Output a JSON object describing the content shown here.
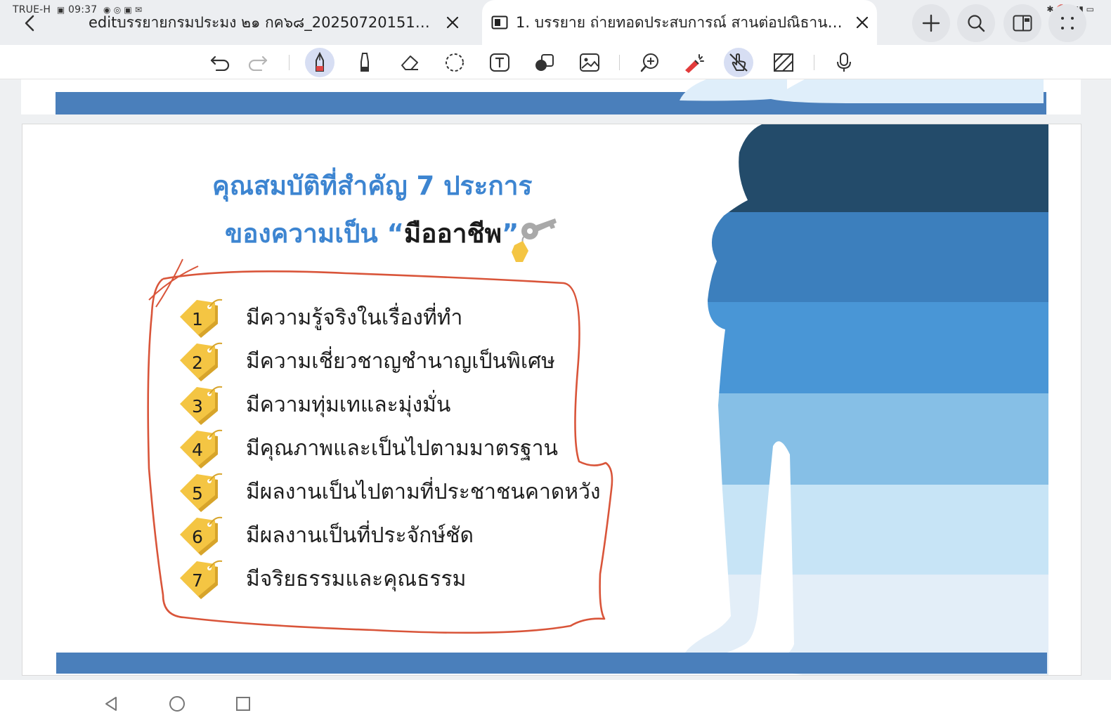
{
  "status_bar": {
    "carrier": "TRUE-H",
    "time": "09:37"
  },
  "tabs": [
    {
      "title": "editบรรยายกรมประมง ๒๑ กค๖๘_202507201515_0...",
      "active": false
    },
    {
      "title": "1. บรรยาย ถ่ายทอดประสบการณ์ สานต่อปณิธาน ...",
      "active": true
    }
  ],
  "top_actions": [
    "plus-icon",
    "search-icon",
    "split-view-icon",
    "more-icon"
  ],
  "toolbar": {
    "tools": [
      "undo-icon",
      "redo-icon",
      "pen-icon",
      "highlighter-icon",
      "eraser-icon",
      "lasso-icon",
      "text-box-icon",
      "shapes-icon",
      "image-icon",
      "zoom-icon",
      "laser-pointer-icon",
      "finger-draw-icon",
      "background-pattern-icon",
      "voice-icon"
    ],
    "active_tools": [
      "pen-icon",
      "finger-draw-icon"
    ]
  },
  "slide": {
    "title_line1": "คุณสมบัติที่สำคัญ 7 ประการ",
    "title_line2_prefix": "ของความเป็น ",
    "title_line2_quote_open": "“",
    "title_line2_emphasis": "มืออาชีพ",
    "title_line2_quote_close": "”",
    "items": [
      {
        "number": "1",
        "text": "มีความรู้จริงในเรื่องที่ทำ"
      },
      {
        "number": "2",
        "text": "มีความเชี่ยวชาญชำนาญเป็นพิเศษ"
      },
      {
        "number": "3",
        "text": "มีความทุ่มเทและมุ่งมั่น"
      },
      {
        "number": "4",
        "text": "มีคุณภาพและเป็นไปตามมาตรฐาน"
      },
      {
        "number": "5",
        "text": "มีผลงานเป็นไปตามที่ประชาชนคาดหวัง"
      },
      {
        "number": "6",
        "text": "มีผลงานเป็นที่ประจักษ์ชัด"
      },
      {
        "number": "7",
        "text": "มีจริยธรรมและคุณธรรม"
      }
    ],
    "colors": {
      "title_blue": "#3d85d1",
      "band_blue": "#4a7fbb",
      "tag_yellow": "#f4c543",
      "ink_red": "#d9553a",
      "silhouette_stripes": [
        "#234b6a",
        "#3c7fbd",
        "#4996d6",
        "#86bfe6",
        "#c7e4f6",
        "#e3eef8"
      ]
    }
  },
  "nav_bar": [
    "back-triangle-icon",
    "home-circle-icon",
    "recents-square-icon"
  ]
}
